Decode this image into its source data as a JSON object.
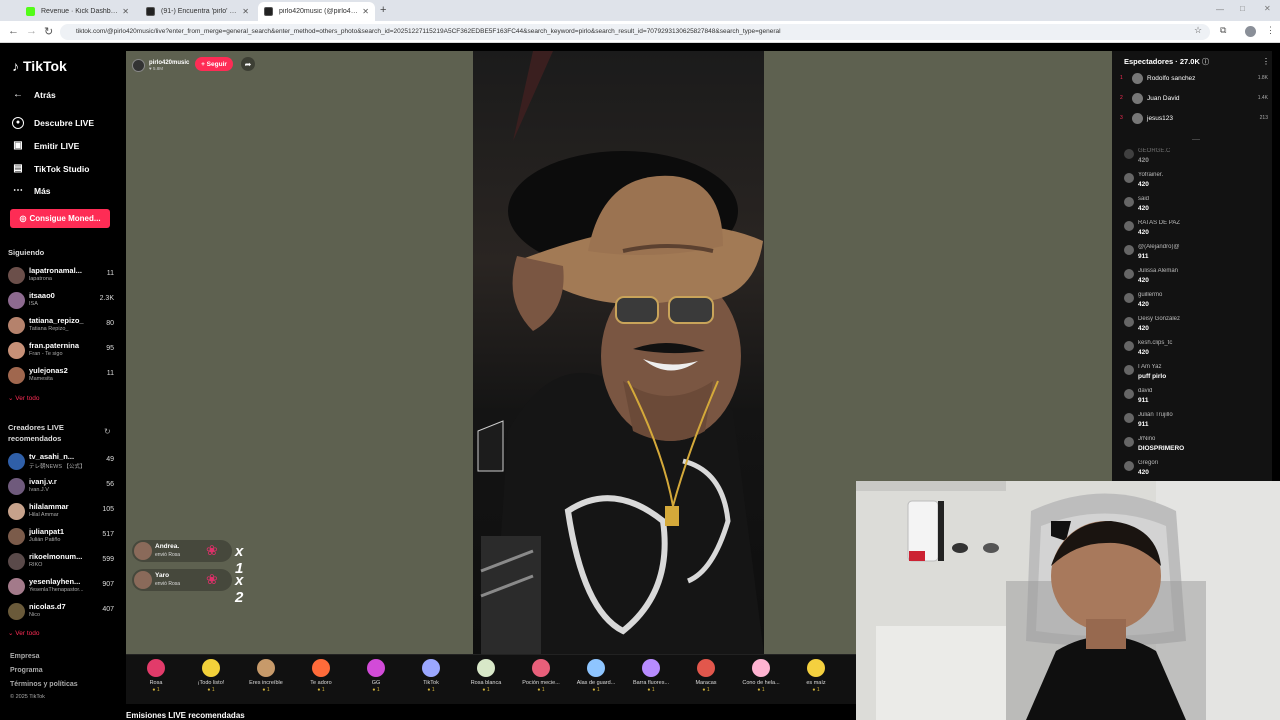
{
  "browser": {
    "tabs": [
      {
        "title": "Revenue · Kick Dashboard",
        "color": "#53fc18"
      },
      {
        "title": "(91-) Encuentra 'pirlo' en TikTok",
        "color": "#222"
      },
      {
        "title": "pirlo420music (@pirlo420music)",
        "color": "#222"
      }
    ],
    "new_tab": "+",
    "url": "tiktok.com/@pirlo420music/live?enter_from_merge=general_search&enter_method=others_photo&search_id=20251227115219A5CF362EDBE5F163FC44&search_keyword=pirlo&search_result_id=7079293130625827848&search_type=general"
  },
  "sidebar": {
    "logo": "TikTok",
    "back": "Atrás",
    "nav": [
      {
        "label": "Descubre LIVE",
        "icon": "live-icon"
      },
      {
        "label": "Emitir LIVE",
        "icon": "broadcast-icon"
      },
      {
        "label": "TikTok Studio",
        "icon": "studio-icon"
      },
      {
        "label": "Más",
        "icon": "more-icon"
      }
    ],
    "coins_button": "Consigue Moned...",
    "following_title": "Siguiendo",
    "following": [
      {
        "name": "lapatronamal...",
        "sub": "lapatrona",
        "count": "11"
      },
      {
        "name": "itsaao0",
        "sub": "ISA",
        "count": "2.3K"
      },
      {
        "name": "tatiana_repizo_",
        "sub": "Tatiana Repizo_",
        "count": "80"
      },
      {
        "name": "fran.paternina",
        "sub": "Fran - Te sigo",
        "count": "95"
      },
      {
        "name": "yulejonas2",
        "sub": "Mamesita",
        "count": "11"
      }
    ],
    "see_all": "Ver todo",
    "recommended_title": "Creadores LIVE recomendados",
    "recommended": [
      {
        "name": "tv_asahi_n...",
        "sub": "テレ朝NEWS 【公式】",
        "count": "49"
      },
      {
        "name": "ivanj.v.r",
        "sub": "Ivan.J.V",
        "count": "56"
      },
      {
        "name": "hilalammar",
        "sub": "Hilal Ammar",
        "count": "105"
      },
      {
        "name": "julianpat1",
        "sub": "Julián Patiño",
        "count": "517"
      },
      {
        "name": "rikoelmonum...",
        "sub": "RIKO",
        "count": "599"
      },
      {
        "name": "yesenlayhen...",
        "sub": "YesenlaThenapastor...",
        "count": "907"
      },
      {
        "name": "nicolas.d7",
        "sub": "Nico",
        "count": "407"
      }
    ],
    "see_all_2": "Ver todo",
    "footer": [
      "Empresa",
      "Programa",
      "Términos y políticas",
      "© 2025 TikTok"
    ]
  },
  "live": {
    "host_name": "pirlo420music",
    "host_likes": "5.8M",
    "follow_label": "+ Seguir",
    "gift_notices": [
      {
        "name": "Andrea.",
        "action": "envió Rosa",
        "mult": "x 1"
      },
      {
        "name": "Yaro",
        "action": "envió Rosa",
        "mult": "x 2"
      }
    ]
  },
  "gifts": [
    {
      "name": "Rosa",
      "cost": "1",
      "color": "#e23b6a"
    },
    {
      "name": "¡Todo listo!",
      "cost": "1",
      "color": "#f2d13a"
    },
    {
      "name": "Eres increíble",
      "cost": "1",
      "color": "#c79a6a"
    },
    {
      "name": "Te adoro",
      "cost": "1",
      "color": "#ff6b3a"
    },
    {
      "name": "GG",
      "cost": "1",
      "color": "#d24bd8"
    },
    {
      "name": "TikTok",
      "cost": "1",
      "color": "#9ba7ff"
    },
    {
      "name": "Rosa blanca",
      "cost": "1",
      "color": "#d8e8c8"
    },
    {
      "name": "Poción mecie...",
      "cost": "1",
      "color": "#e85f7a"
    },
    {
      "name": "Alas de guard...",
      "cost": "1",
      "color": "#8ec5ff"
    },
    {
      "name": "Barra fluores...",
      "cost": "1",
      "color": "#b88cff"
    },
    {
      "name": "Maracas",
      "cost": "1",
      "color": "#e2574c"
    },
    {
      "name": "Cono de hela...",
      "cost": "1",
      "color": "#ffb3d1"
    },
    {
      "name": "es maíz",
      "cost": "1",
      "color": "#f4d03f"
    }
  ],
  "recommended_streams": "Emisiones LIVE recomendadas",
  "panel": {
    "viewers_title": "Espectadores · 27.0K",
    "top_viewers": [
      {
        "rank": "1",
        "name": "Rodolfo sanchez",
        "score": "1.8K"
      },
      {
        "rank": "2",
        "name": "Juan David",
        "score": "1.4K"
      },
      {
        "rank": "3",
        "name": "jesus123",
        "score": "213"
      }
    ],
    "chat": [
      {
        "user": "GEORGE.C",
        "msg": "420"
      },
      {
        "user": "Yofrainer.",
        "msg": "420"
      },
      {
        "user": "said",
        "msg": "420"
      },
      {
        "user": "RATAS DE PAZ",
        "msg": "420"
      },
      {
        "user": "@(Alejandro)@",
        "msg": "911"
      },
      {
        "user": "Julissa Aleman",
        "msg": "420"
      },
      {
        "user": "guillermo",
        "msg": "420"
      },
      {
        "user": "Deisy González",
        "msg": "420"
      },
      {
        "user": "kesh.clips_tc",
        "msg": "420"
      },
      {
        "user": "I Am Yaz",
        "msg": "puff pirlo"
      },
      {
        "user": "david",
        "msg": "911"
      },
      {
        "user": "Julián Trujillo",
        "msg": "911"
      },
      {
        "user": "JrNiño",
        "msg": "DIOSPRIMERO"
      },
      {
        "user": "Gregori",
        "msg": "420"
      }
    ]
  }
}
